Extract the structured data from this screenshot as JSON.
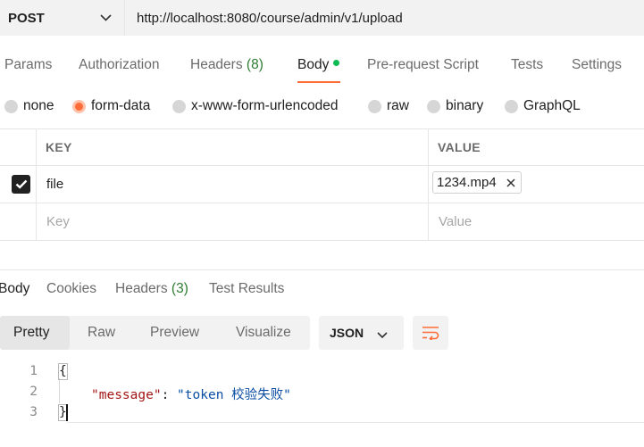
{
  "request": {
    "method": "POST",
    "url": "http://localhost:8080/course/admin/v1/upload"
  },
  "request_tabs": [
    {
      "label": "Params"
    },
    {
      "label": "Authorization"
    },
    {
      "label": "Headers",
      "count": "(8)"
    },
    {
      "label": "Body",
      "active": true,
      "indicator": "green-dot"
    },
    {
      "label": "Pre-request Script"
    },
    {
      "label": "Tests"
    },
    {
      "label": "Settings"
    }
  ],
  "body_types": [
    {
      "label": "none"
    },
    {
      "label": "form-data",
      "selected": true
    },
    {
      "label": "x-www-form-urlencoded"
    },
    {
      "label": "raw"
    },
    {
      "label": "binary"
    },
    {
      "label": "GraphQL"
    }
  ],
  "params_table": {
    "headers": [
      "KEY",
      "VALUE"
    ],
    "rows": [
      {
        "enabled": true,
        "key": "file",
        "value": "1234.mp4"
      }
    ],
    "placeholder": {
      "key": "Key",
      "value": "Value"
    }
  },
  "response_tabs": [
    {
      "label": "Body",
      "active": true
    },
    {
      "label": "Cookies"
    },
    {
      "label": "Headers",
      "count": "(3)"
    },
    {
      "label": "Test Results"
    }
  ],
  "view_modes": [
    "Pretty",
    "Raw",
    "Preview",
    "Visualize"
  ],
  "active_view_mode": "Pretty",
  "format": "JSON",
  "response_body": {
    "line_numbers": [
      "1",
      "2",
      "3"
    ],
    "open_brace": "{",
    "close_brace": "}",
    "key": "\"message\"",
    "colon": ": ",
    "value": "\"token 校验失败\""
  },
  "colors": {
    "accent": "#ff6c37",
    "active_dot": "#0cbb52",
    "json_key": "#a31515",
    "json_string": "#0b4ea2"
  }
}
